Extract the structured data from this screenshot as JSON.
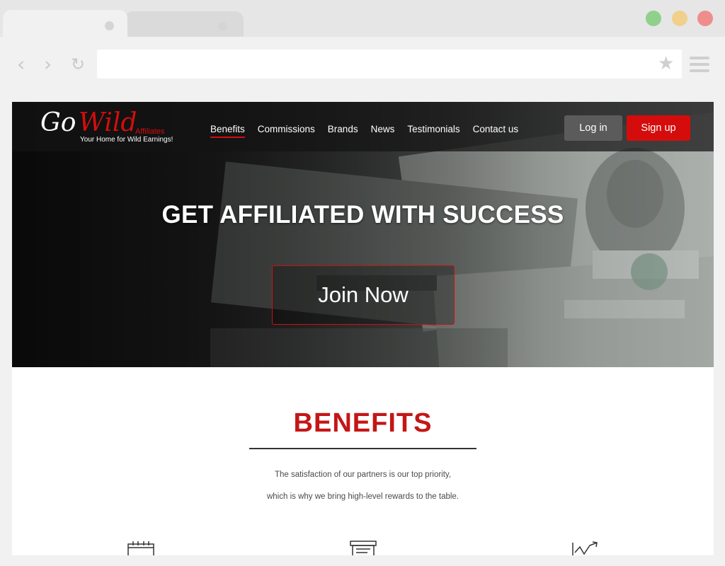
{
  "browser": {
    "icons": [
      "back-arrow-icon",
      "forward-arrow-icon",
      "reload-icon",
      "star-icon",
      "hamburger-menu-icon"
    ],
    "traffic_lights": [
      "#8fd18b",
      "#f1cf8c",
      "#ef8d8d"
    ]
  },
  "site": {
    "logo": {
      "go": "Go",
      "wild": "Wild",
      "affiliates": "Affiliates",
      "tagline": "Your Home for Wild Earnings!"
    },
    "nav": {
      "items": [
        {
          "label": "Benefits",
          "active": true
        },
        {
          "label": "Commissions"
        },
        {
          "label": "Brands"
        },
        {
          "label": "News"
        },
        {
          "label": "Testimonials"
        },
        {
          "label": "Contact us"
        }
      ]
    },
    "login_label": "Log in",
    "signup_label": "Sign up"
  },
  "hero": {
    "title": "GET AFFILIATED WITH SUCCESS",
    "cta_label": "Join Now"
  },
  "benefits": {
    "title": "BENEFITS",
    "lines": [
      "The satisfaction of our partners is our top priority,",
      "which is why we bring high-level rewards to the table."
    ],
    "icons": [
      "calendar-icon",
      "document-stack-icon",
      "growth-chart-icon"
    ]
  },
  "colors": {
    "brand_red": "#d50c0c",
    "benefits_title": "#c41616",
    "login_button": "#5b5b5b"
  }
}
